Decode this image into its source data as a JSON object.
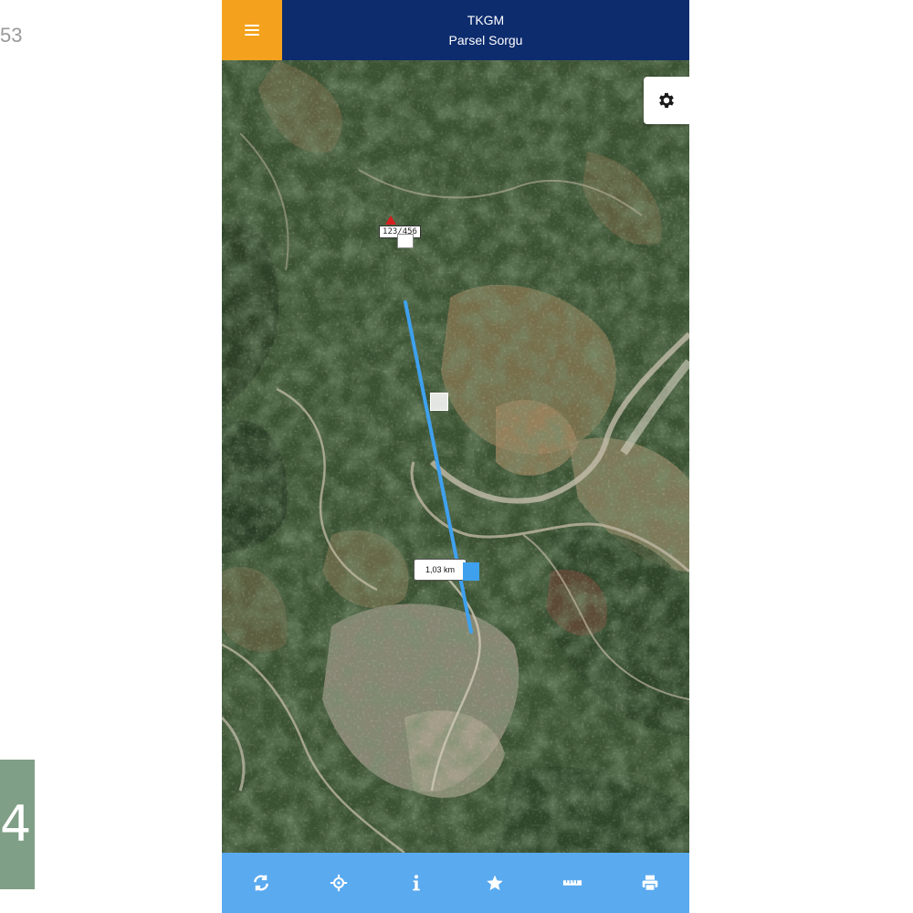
{
  "background": {
    "left_fragment_text": "53"
  },
  "header": {
    "title": "TKGM",
    "subtitle": "Parsel Sorgu",
    "menu_icon": "hamburger-icon",
    "bg_color": "#0d2c6e",
    "menu_color": "#f4a21d"
  },
  "map": {
    "settings_icon": "gear-icon",
    "parcel_label": "123/456",
    "distance_label": "1,03 km",
    "measure_line_color": "#3fa1ee"
  },
  "toolbar": {
    "bg_color": "#5aaaf0",
    "buttons": [
      {
        "name": "refresh",
        "icon": "refresh-icon"
      },
      {
        "name": "locate",
        "icon": "crosshair-icon"
      },
      {
        "name": "info",
        "icon": "info-icon"
      },
      {
        "name": "favorites",
        "icon": "star-icon"
      },
      {
        "name": "measure",
        "icon": "ruler-icon"
      },
      {
        "name": "print",
        "icon": "print-icon"
      }
    ]
  }
}
